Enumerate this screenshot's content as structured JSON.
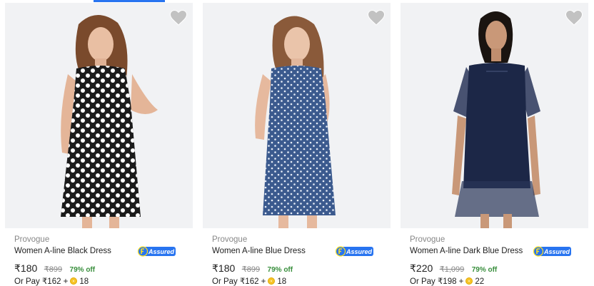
{
  "products": [
    {
      "brand": "Provogue",
      "title": "Women A-line Black Dress",
      "price": "₹180",
      "mrp": "₹899",
      "discount": "79% off",
      "pay_prefix": "Or Pay ₹162 +",
      "coins": "18",
      "assured_label": "Assured",
      "image_icon": "polka-black-dress-model",
      "dress_color": "#1b1b1b",
      "dot_color": "#ffffff"
    },
    {
      "brand": "Provogue",
      "title": "Women A-line Blue Dress",
      "price": "₹180",
      "mrp": "₹899",
      "discount": "79% off",
      "pay_prefix": "Or Pay ₹162 +",
      "coins": "18",
      "assured_label": "Assured",
      "image_icon": "polka-blue-dress-model",
      "dress_color": "#3b5a8e",
      "dot_color": "#e8eef8"
    },
    {
      "brand": "Provogue",
      "title": "Women A-line Dark Blue Dress",
      "price": "₹220",
      "mrp": "₹1,099",
      "discount": "79% off",
      "pay_prefix": "Or Pay ₹198 +",
      "coins": "22",
      "assured_label": "Assured",
      "image_icon": "sheer-navy-dress-model",
      "dress_color": "#1c2747",
      "dot_color": ""
    }
  ],
  "colors": {
    "accent": "#2874f0",
    "discount_green": "#388e3c",
    "muted": "#878787",
    "wishlist_gray": "#c2c2c2",
    "assured_yellow": "#ffe11b"
  }
}
